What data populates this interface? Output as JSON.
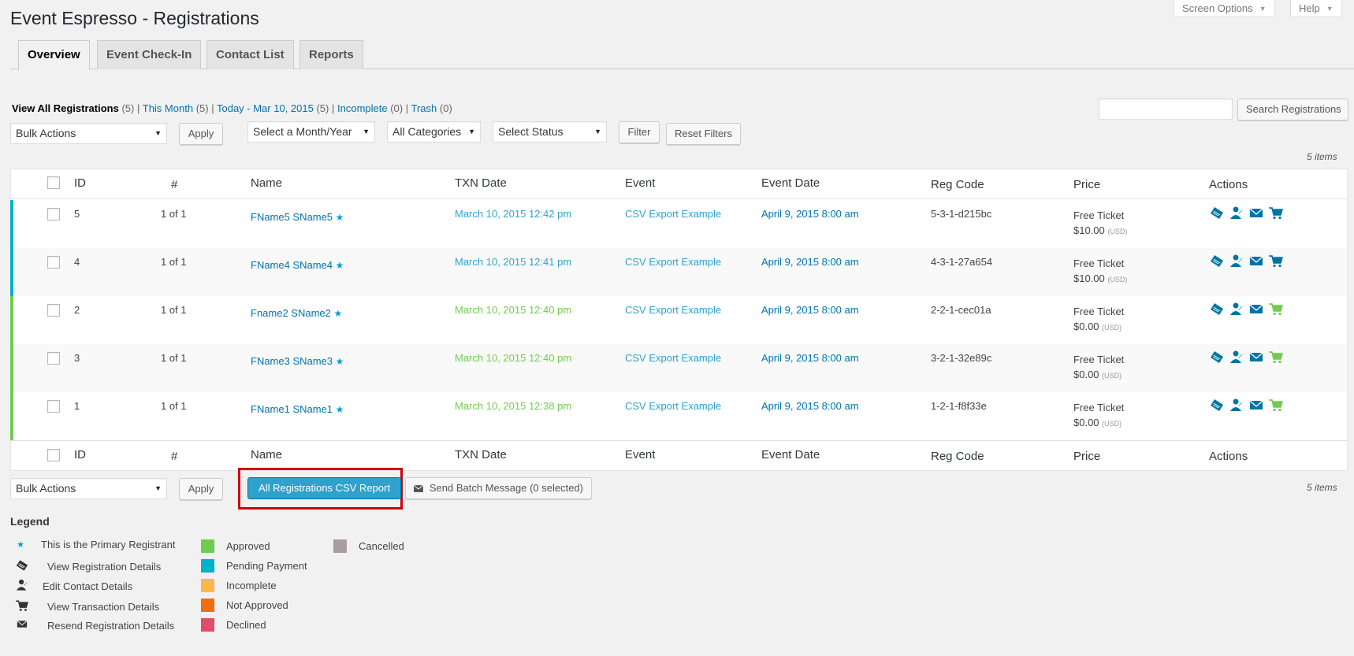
{
  "page": {
    "title": "Event Espresso - Registrations"
  },
  "top_buttons": {
    "screen_options": "Screen Options",
    "help": "Help"
  },
  "tabs": [
    {
      "label": "Overview",
      "active": true
    },
    {
      "label": "Event Check-In",
      "active": false
    },
    {
      "label": "Contact List",
      "active": false
    },
    {
      "label": "Reports",
      "active": false
    }
  ],
  "views": {
    "all": {
      "label": "View All Registrations",
      "count": "(5)"
    },
    "month": {
      "label": "This Month",
      "count": "(5)"
    },
    "today": {
      "label": "Today - Mar 10, 2015",
      "count": "(5)"
    },
    "incomplete": {
      "label": "Incomplete",
      "count": "(0)"
    },
    "trash": {
      "label": "Trash",
      "count": "(0)"
    },
    "separator": "|"
  },
  "filters": {
    "bulk_actions": "Bulk Actions",
    "apply": "Apply",
    "month_year": "Select a Month/Year",
    "categories": "All Categories",
    "status": "Select Status",
    "filter": "Filter",
    "reset": "Reset Filters"
  },
  "search": {
    "value": "",
    "button": "Search Registrations"
  },
  "items_count": "5 items",
  "columns": {
    "id": "ID",
    "num": "#",
    "name": "Name",
    "txn_date": "TXN Date",
    "event": "Event",
    "event_date": "Event Date",
    "reg_code": "Reg Code",
    "price": "Price",
    "actions": "Actions"
  },
  "rows": [
    {
      "id": "5",
      "num": "1 of 1",
      "name": "FName5 SName5",
      "star": "★",
      "txn_date": "March 10, 2015 12:42 pm",
      "event": "CSV Export Example",
      "event_date": "April 9, 2015 8:00 am",
      "reg_code": "5-3-1-d215bc",
      "ticket": "Free Ticket",
      "amount": "$10.00",
      "currency": "(USD)",
      "status_color": "#00b1ca"
    },
    {
      "id": "4",
      "num": "1 of 1",
      "name": "FName4 SName4",
      "star": "★",
      "txn_date": "March 10, 2015 12:41 pm",
      "event": "CSV Export Example",
      "event_date": "April 9, 2015 8:00 am",
      "reg_code": "4-3-1-27a654",
      "ticket": "Free Ticket",
      "amount": "$10.00",
      "currency": "(USD)",
      "status_color": "#00b1ca"
    },
    {
      "id": "2",
      "num": "1 of 1",
      "name": "Fname2 SName2",
      "star": "★",
      "txn_date": "March 10, 2015 12:40 pm",
      "event": "CSV Export Example",
      "event_date": "April 9, 2015 8:00 am",
      "reg_code": "2-2-1-cec01a",
      "ticket": "Free Ticket",
      "amount": "$0.00",
      "currency": "(USD)",
      "status_color": "#70cc50"
    },
    {
      "id": "3",
      "num": "1 of 1",
      "name": "FName3 SName3",
      "star": "★",
      "txn_date": "March 10, 2015 12:40 pm",
      "event": "CSV Export Example",
      "event_date": "April 9, 2015 8:00 am",
      "reg_code": "3-2-1-32e89c",
      "ticket": "Free Ticket",
      "amount": "$0.00",
      "currency": "(USD)",
      "status_color": "#70cc50"
    },
    {
      "id": "1",
      "num": "1 of 1",
      "name": "FName1 SName1",
      "star": "★",
      "txn_date": "March 10, 2015 12:38 pm",
      "event": "CSV Export Example",
      "event_date": "April 9, 2015 8:00 am",
      "reg_code": "1-2-1-f8f33e",
      "ticket": "Free Ticket",
      "amount": "$0.00",
      "currency": "(USD)",
      "status_color": "#70cc50"
    }
  ],
  "bottom": {
    "csv_report": "All Registrations CSV Report",
    "batch_message": "Send Batch Message (0 selected)"
  },
  "legend": {
    "title": "Legend",
    "icons": [
      {
        "icon": "star-icon",
        "label": "This is the Primary Registrant"
      },
      {
        "icon": "ticket-icon",
        "label": "View Registration Details"
      },
      {
        "icon": "contact-icon",
        "label": "Edit Contact Details"
      },
      {
        "icon": "cart-icon",
        "label": "View Transaction Details"
      },
      {
        "icon": "envelope-icon",
        "label": "Resend Registration Details"
      }
    ],
    "statuses": [
      {
        "label": "Approved",
        "color": "#70cc50"
      },
      {
        "label": "Pending Payment",
        "color": "#00b1ca"
      },
      {
        "label": "Incomplete",
        "color": "#fbb847"
      },
      {
        "label": "Not Approved",
        "color": "#f06e0e"
      },
      {
        "label": "Declined",
        "color": "#e24b6a"
      },
      {
        "label": "Cancelled",
        "color": "#ab9d9d"
      }
    ]
  },
  "colors": {
    "link": "#0073aa",
    "approved": "#70cc50",
    "pending": "#00b1ca",
    "icon_blue": "#0074a2"
  }
}
